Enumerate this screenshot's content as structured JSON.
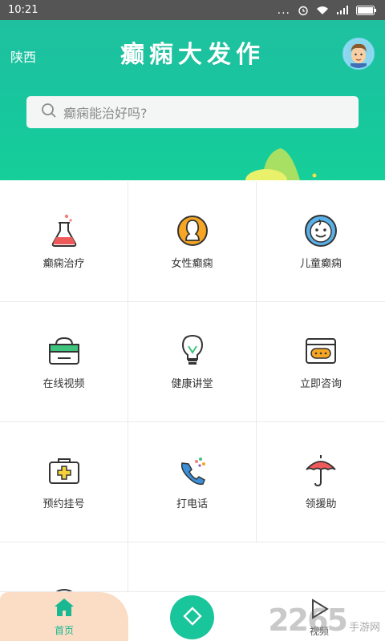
{
  "status_bar": {
    "time": "10:21",
    "dots": "...",
    "battery": "battery-icon"
  },
  "header": {
    "region": "陕西",
    "title": "癫痫大发作",
    "search_placeholder": "癫痫能治好吗?"
  },
  "grid": {
    "items": [
      {
        "label": "癫痫治疗",
        "icon": "flask-icon"
      },
      {
        "label": "女性癫痫",
        "icon": "female-icon"
      },
      {
        "label": "儿童癫痫",
        "icon": "child-face-icon"
      },
      {
        "label": "在线视频",
        "icon": "video-bag-icon"
      },
      {
        "label": "健康讲堂",
        "icon": "lightbulb-icon"
      },
      {
        "label": "立即咨询",
        "icon": "chat-window-icon"
      },
      {
        "label": "预约挂号",
        "icon": "first-aid-kit-icon"
      },
      {
        "label": "打电话",
        "icon": "phone-icon"
      },
      {
        "label": "领援助",
        "icon": "umbrella-icon"
      },
      {
        "label": "",
        "icon": "partial-icon"
      }
    ]
  },
  "bottom_nav": {
    "home_label": "首页",
    "video_label": "视频"
  },
  "watermark": {
    "number": "2265",
    "text": "手游网"
  },
  "colors": {
    "brand": "#17c79d",
    "home_tab_bg": "#fbdcc5",
    "orange": "#f6a623"
  }
}
